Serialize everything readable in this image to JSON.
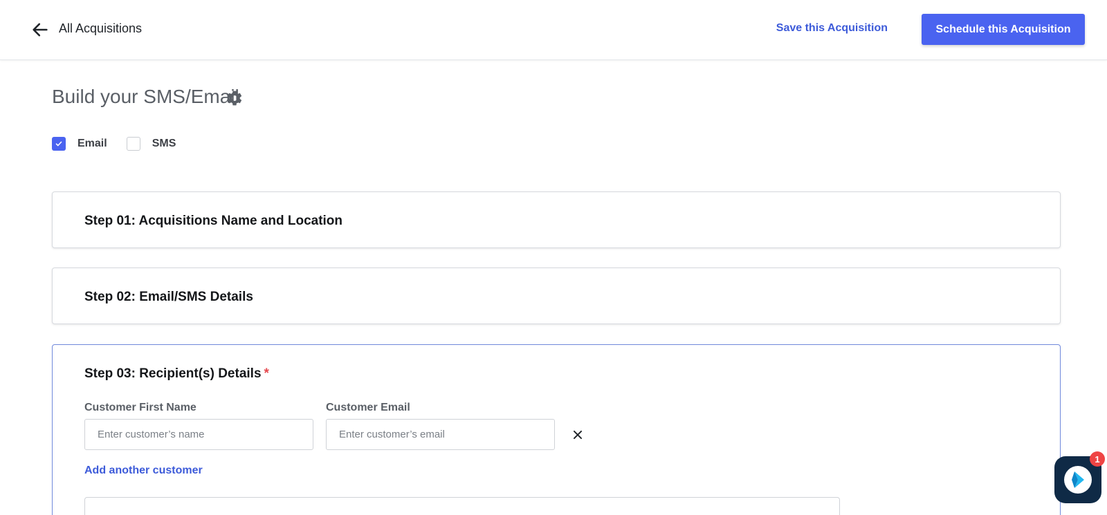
{
  "header": {
    "back_label": "All Acquisitions",
    "save_label": "Save this Acquisition",
    "schedule_label": "Schedule this Acquisition"
  },
  "page": {
    "title": "Build your SMS/Email",
    "channels": [
      {
        "label": "Email",
        "checked": true
      },
      {
        "label": "SMS",
        "checked": false
      }
    ]
  },
  "steps": [
    {
      "title": "Step 01: Acquisitions Name and Location"
    },
    {
      "title": "Step 02: Email/SMS Details"
    },
    {
      "title": "Step 03: Recipient(s) Details",
      "required_mark": "*"
    }
  ],
  "recipients": {
    "first_name_label": "Customer First Name",
    "first_name_placeholder": "Enter customer’s name",
    "first_name_value": "",
    "email_label": "Customer Email",
    "email_placeholder": "Enter customer’s email",
    "email_value": "",
    "add_label": "Add another customer"
  },
  "chat": {
    "badge_count": "1"
  },
  "colors": {
    "accent": "#4a63f0",
    "link": "#3d5bd9",
    "required": "#e5484d",
    "chat_bg": "#0f2a46"
  }
}
